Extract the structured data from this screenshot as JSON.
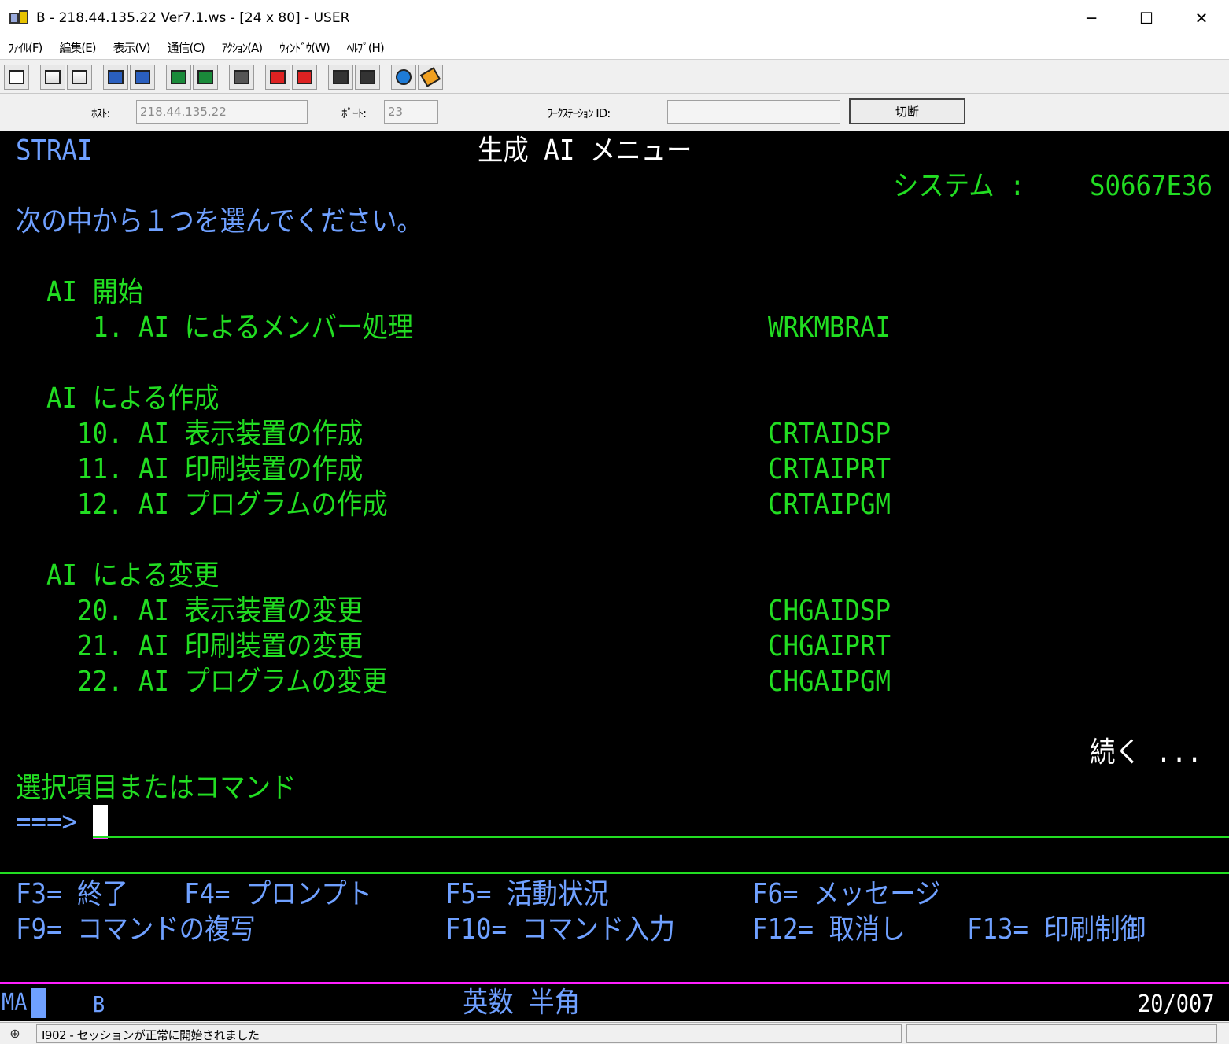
{
  "window": {
    "title": "B - 218.44.135.22 Ver7.1.ws - [24 x 80] - USER",
    "minimize": "─",
    "maximize": "☐",
    "close": "✕"
  },
  "menu": {
    "items": [
      "ﾌｧｲﾙ(F)",
      "編集(E)",
      "表示(V)",
      "通信(C)",
      "ｱｸｼｮﾝ(A)",
      "ｳｨﾝﾄﾞｳ(W)",
      "ﾍﾙﾌﾟ(H)"
    ]
  },
  "connection": {
    "host_label": "ﾎｽﾄ:",
    "host_value": "218.44.135.22",
    "port_label": "ﾎﾟｰﾄ:",
    "port_value": "23",
    "workstation_label": "ﾜｰｸｽﾃｰｼｮﾝ ID:",
    "workstation_value": "",
    "disconnect_label": "切断"
  },
  "screen": {
    "menu_id": "STRAI",
    "title": "生成 AI メニュー",
    "system_label": "システム :",
    "system_value": "S0667E36",
    "instruction": "次の中から１つを選んでください。",
    "sections": [
      {
        "heading": "AI 開始",
        "options": [
          {
            "number": "1.",
            "label": "AI によるメンバー処理",
            "command": "WRKMBRAI"
          }
        ]
      },
      {
        "heading": "AI による作成",
        "options": [
          {
            "number": "10.",
            "label": "AI 表示装置の作成",
            "command": "CRTAIDSP"
          },
          {
            "number": "11.",
            "label": "AI 印刷装置の作成",
            "command": "CRTAIPRT"
          },
          {
            "number": "12.",
            "label": "AI プログラムの作成",
            "command": "CRTAIPGM"
          }
        ]
      },
      {
        "heading": "AI による変更",
        "options": [
          {
            "number": "20.",
            "label": "AI 表示装置の変更",
            "command": "CHGAIDSP"
          },
          {
            "number": "21.",
            "label": "AI 印刷装置の変更",
            "command": "CHGAIPRT"
          },
          {
            "number": "22.",
            "label": "AI プログラムの変更",
            "command": "CHGAIPGM"
          }
        ]
      }
    ],
    "more": "続く ...",
    "command_label": "選択項目またはコマンド",
    "prompt": "===>",
    "command_value": "",
    "fkeys_row1": [
      "F3= 終了",
      "F4= プロンプト",
      "F5= 活動状況",
      "F6= メッセージ"
    ],
    "fkeys_row2": [
      "F9= コマンドの複写",
      "F10= コマンド入力",
      "F12= 取消し",
      "F13= 印刷制御"
    ],
    "oia_left": "MA",
    "oia_session": "B",
    "oia_mode": "英数 半角",
    "oia_cursor": "20/007"
  },
  "statusbar": {
    "message": "I902 - セッションが正常に開始されました"
  },
  "colors": {
    "terminal_bg": "#000000",
    "green": "#22dd22",
    "blue": "#6fa0ff",
    "white": "#ffffff",
    "magenta": "#ff20ff"
  }
}
